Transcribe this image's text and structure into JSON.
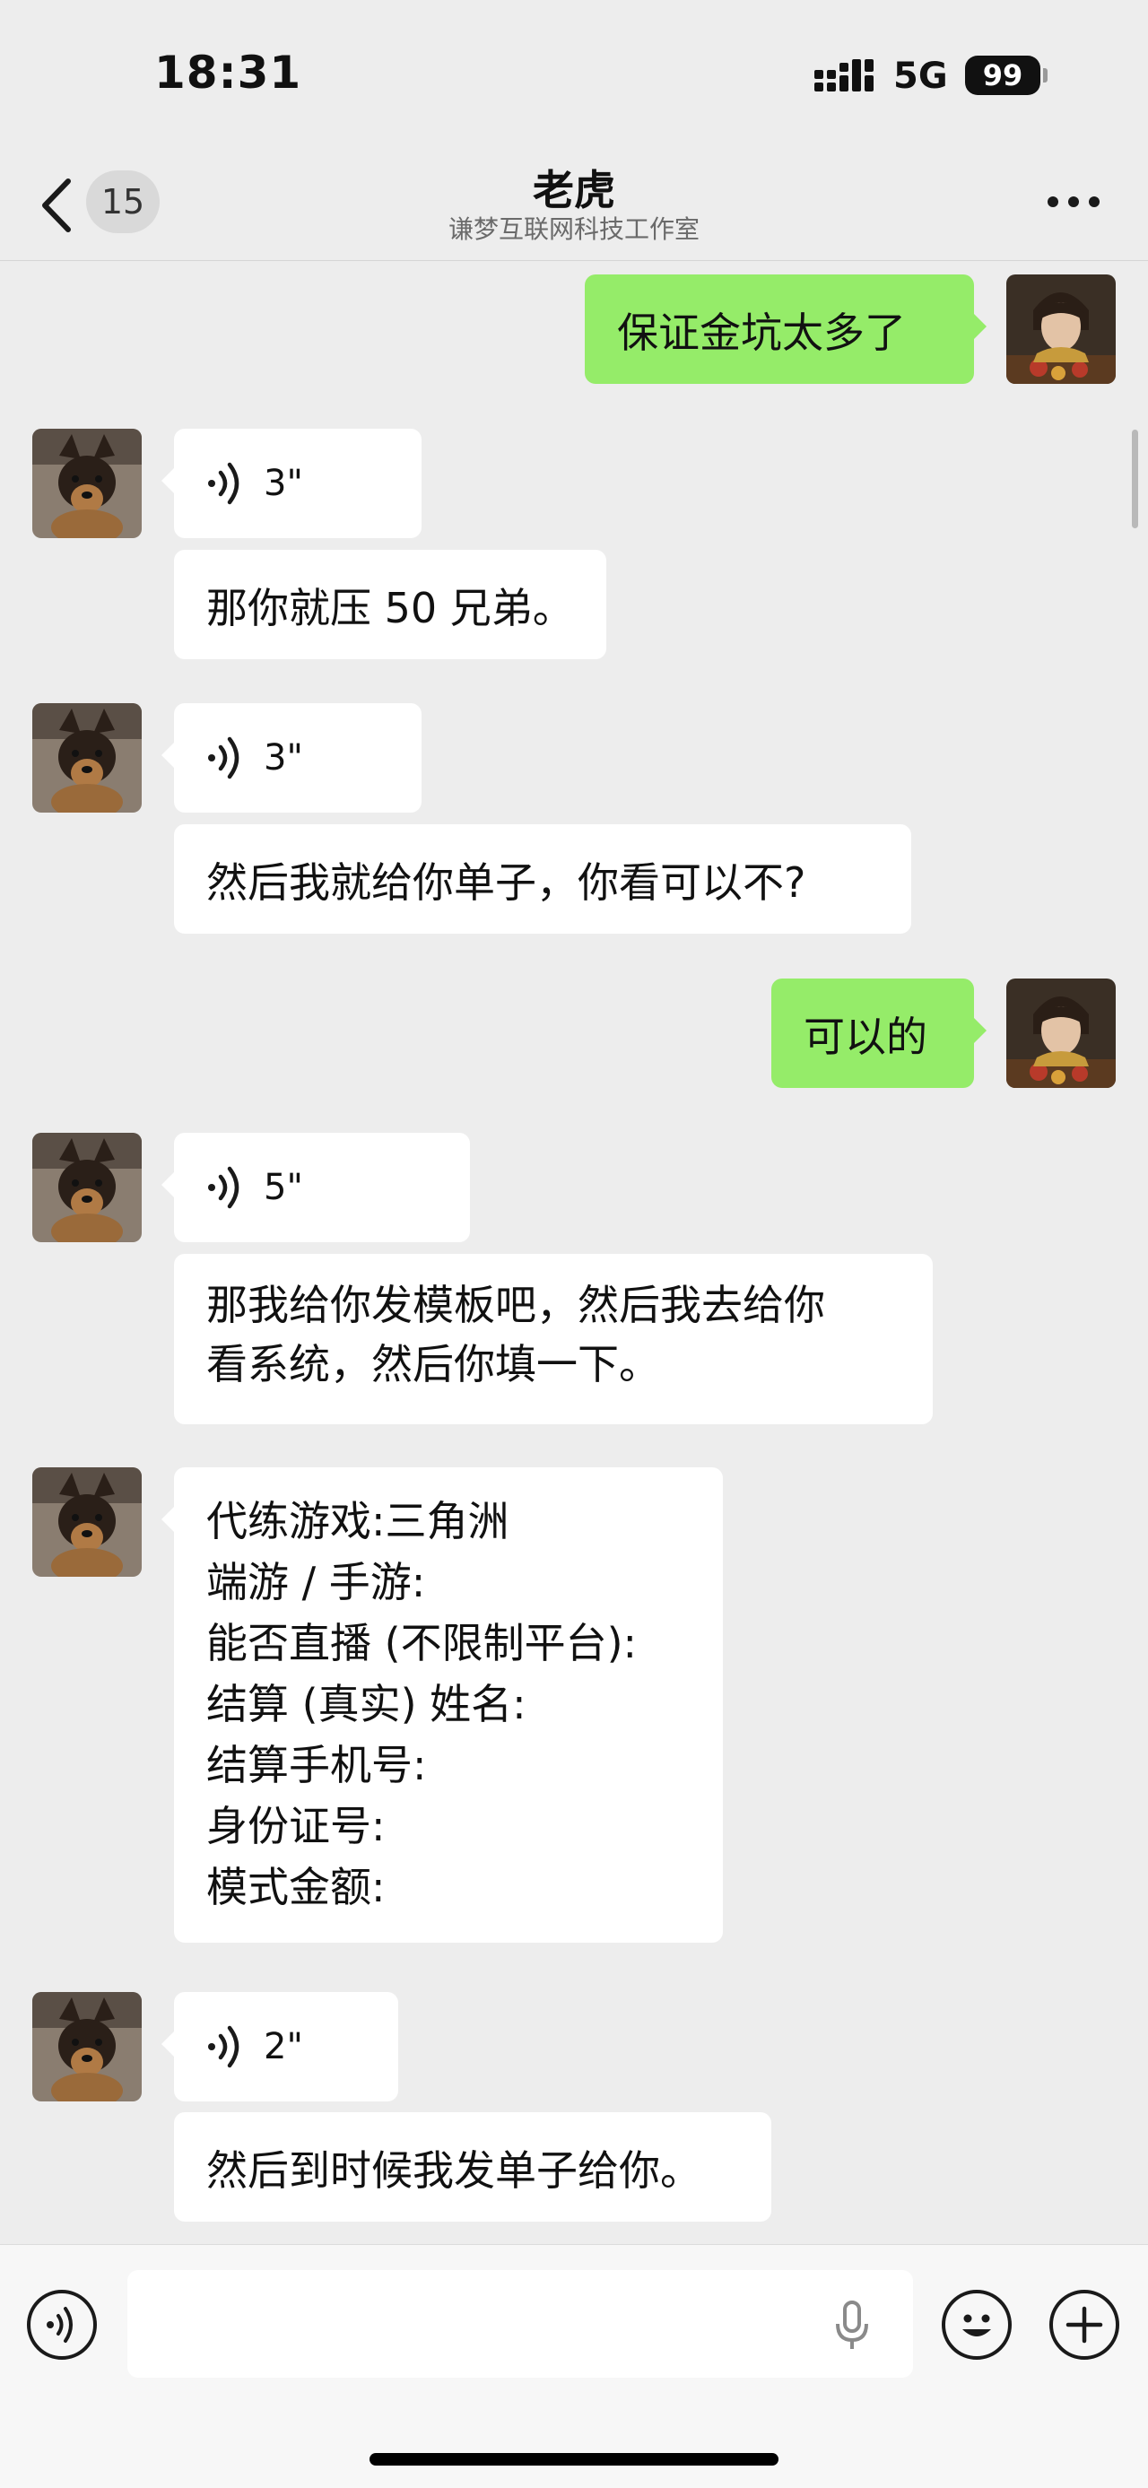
{
  "status_bar": {
    "time": "18:31",
    "network": "5G",
    "battery": "99"
  },
  "nav": {
    "back_badge": "15",
    "title": "老虎",
    "subtitle": "谦梦互联网科技工作室"
  },
  "messages": [
    {
      "side": "right",
      "type": "text",
      "text": "保证金坑太多了"
    },
    {
      "side": "left",
      "type": "voice",
      "duration": "3\""
    },
    {
      "side": "left",
      "type": "text",
      "text": "那你就压 50 兄弟。"
    },
    {
      "side": "left",
      "type": "voice",
      "duration": "3\""
    },
    {
      "side": "left",
      "type": "text",
      "text": "然后我就给你单子，你看可以不?"
    },
    {
      "side": "right",
      "type": "text",
      "text": "可以的"
    },
    {
      "side": "left",
      "type": "voice",
      "duration": "5\""
    },
    {
      "side": "left",
      "type": "text",
      "text": "那我给你发模板吧，然后我去给你\n看系统，然后你填一下。"
    },
    {
      "side": "left",
      "type": "text",
      "text": "代练游戏:三角洲\n端游 / 手游:\n能否直播 (不限制平台):\n结算 (真实) 姓名:\n结算手机号:\n身份证号:\n模式金额:"
    },
    {
      "side": "left",
      "type": "voice",
      "duration": "2\""
    },
    {
      "side": "left",
      "type": "text",
      "text": "然后到时候我发单子给你。"
    }
  ],
  "colors": {
    "my_bubble": "#95ec69",
    "their_bubble": "#ffffff",
    "background": "#ededed"
  },
  "input_bar": {
    "icons": [
      "voice-input-icon",
      "microphone-icon",
      "emoji-icon",
      "plus-icon"
    ]
  }
}
